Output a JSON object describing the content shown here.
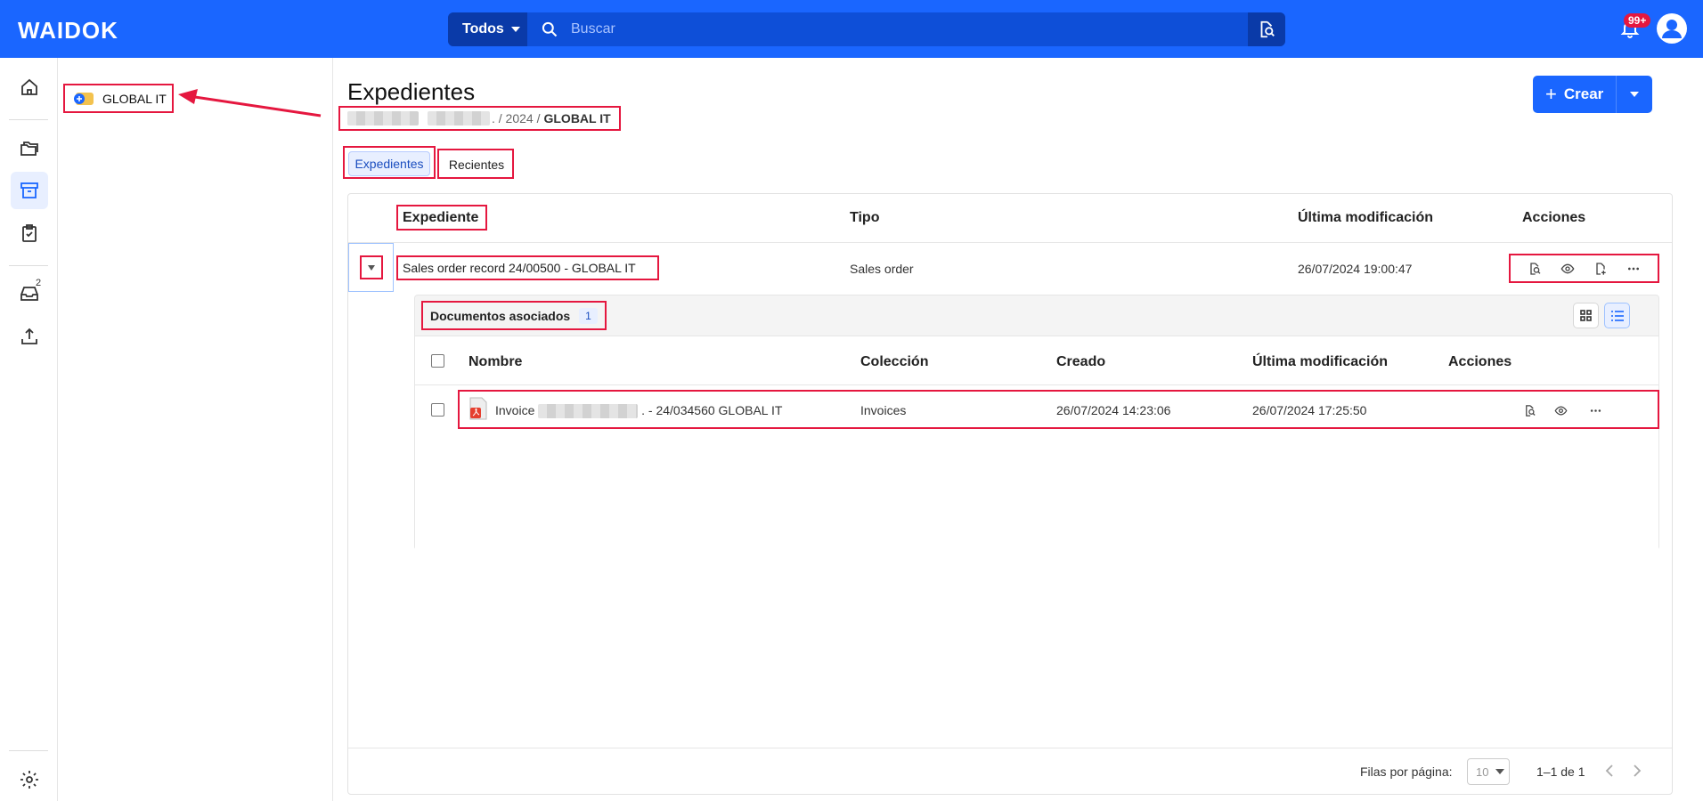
{
  "header": {
    "logo": "WAIDOK",
    "search_scope": "Todos",
    "search_placeholder": "Buscar",
    "notifications_badge": "99+",
    "brand_color": "#1a66ff"
  },
  "rail": {
    "items": [
      {
        "icon": "home-icon"
      },
      {
        "icon": "folders-icon"
      },
      {
        "icon": "archive-icon",
        "active": true
      },
      {
        "icon": "clipboard-check-icon"
      },
      {
        "icon": "inbox-icon",
        "count": "2"
      },
      {
        "icon": "upload-icon"
      },
      {
        "icon": "settings-icon"
      }
    ]
  },
  "tree": {
    "node_label": "GLOBAL IT"
  },
  "page": {
    "title": "Expedientes",
    "breadcrumb_year": ". / 2024 /",
    "breadcrumb_current": "GLOBAL IT",
    "create_label": "Crear"
  },
  "tabs": {
    "active": "Expedientes",
    "other": "Recientes"
  },
  "table": {
    "columns": [
      "Expediente",
      "Tipo",
      "Última modificación",
      "Acciones"
    ],
    "row": {
      "name": "Sales order record 24/00500 - GLOBAL IT",
      "type": "Sales order",
      "modified": "26/07/2024 19:00:47"
    }
  },
  "documents": {
    "title": "Documentos asociados",
    "count": "1",
    "columns": [
      "Nombre",
      "Colección",
      "Creado",
      "Última modificación",
      "Acciones"
    ],
    "row": {
      "name_prefix": "Invoice",
      "name_suffix": ". - 24/034560 GLOBAL IT",
      "collection": "Invoices",
      "created": "26/07/2024 14:23:06",
      "modified": "26/07/2024 17:25:50"
    }
  },
  "pagination": {
    "rows_label": "Filas por página:",
    "rows_value": "10",
    "range": "1–1 de 1"
  },
  "annotation_color": "#e5173f"
}
